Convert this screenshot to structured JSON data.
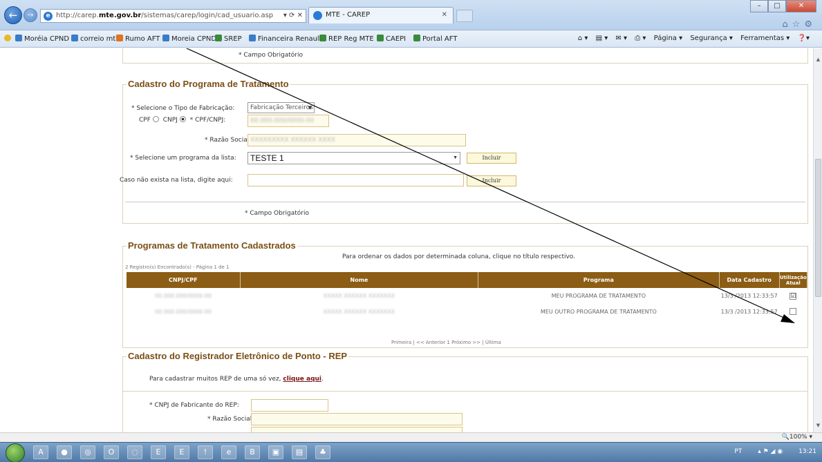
{
  "browser": {
    "url_prefix": "http://carep.",
    "url_domain": "mte.gov.br",
    "url_path": "/sistemas/carep/login/cad_usuario.asp",
    "tab_title": "MTE - CAREP",
    "favorites": [
      "Moréia CPND",
      "correio mte",
      "Rumo AFT",
      "Moreia CPND",
      "SREP",
      "Financeira Renault",
      "REP Reg MTE",
      "CAEPI",
      "Portal AFT"
    ],
    "commands": [
      "Página ▾",
      "Segurança ▾",
      "Ferramentas ▾"
    ],
    "zoom": "100%",
    "clock": "13:21",
    "lang": "PT"
  },
  "page": {
    "top_required_note": "* Campo Obrigatório",
    "programa": {
      "legend": "Cadastro do Programa de Tratamento",
      "tipo_label": "* Selecione o Tipo de Fabricação:",
      "tipo_value": "Fabricação Terceiros",
      "cpf_label": "CPF",
      "cnpj_label": "CNPJ",
      "cpfcnpj_label": "* CPF/CNPJ:",
      "cpfcnpj_value": "00.000.000/0000-00",
      "razao_label": "* Razão Social:",
      "razao_value": "XXXXXXXXX XXXXXX XXXX",
      "programa_label": "* Selecione um programa da lista:",
      "programa_value": "TESTE 1",
      "incluir": "Incluir",
      "caso_label": "Caso não exista na lista, digite aqui:",
      "required_note": "* Campo Obrigatório"
    },
    "cadastrados": {
      "legend": "Programas de Tratamento Cadastrados",
      "order_note": "Para ordenar os dados por determinada coluna, clique no título respectivo.",
      "records": "2 Registro(s) Encontrado(s) - Página 1 de 1",
      "headers": [
        "CNPJ/CPF",
        "Nome",
        "Programa",
        "Data Cadastro",
        "Utilização Atual"
      ],
      "rows": [
        {
          "doc": "00.000.000/0000-00",
          "nome": "XXXXX XXXXXX XXXXXXX",
          "programa": "MEU PROGRAMA DE TRATAMENTO",
          "data": "13/3 /2013 12:33:57",
          "atual": "☑"
        },
        {
          "doc": "00.000.000/0000-00",
          "nome": "XXXXX XXXXXX XXXXXXX",
          "programa": "MEU OUTRO PROGRAMA DE TRATAMENTO",
          "data": "13/3 /2013 12:33:57",
          "atual": ""
        }
      ],
      "pager": "Primeira | << Anterior 1 Próximo >> | Última"
    },
    "rep": {
      "legend": "Cadastro do Registrador Eletrônico de Ponto - REP",
      "intro": "Para cadastrar muitos REP de uma só vez,",
      "link": "clique aqui",
      "cnpj_label": "* CNPJ de Fabricante do REP:",
      "razao_label": "* Razão Social:"
    }
  }
}
